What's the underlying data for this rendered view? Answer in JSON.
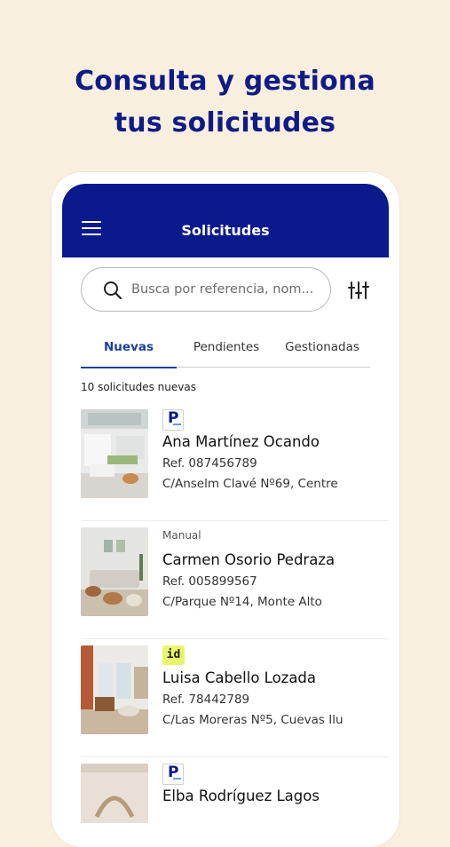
{
  "headline": {
    "line1": "Consulta y gestiona",
    "line2": "tus solicitudes"
  },
  "appbar": {
    "title": "Solicitudes",
    "menu_icon": "hamburger-menu-icon"
  },
  "search": {
    "placeholder": "Busca por referencia, nom...",
    "icon": "search-icon",
    "filter_icon": "filter-sliders-icon"
  },
  "tabs": [
    {
      "label": "Nuevas",
      "active": true
    },
    {
      "label": "Pendientes",
      "active": false
    },
    {
      "label": "Gestionadas",
      "active": false
    }
  ],
  "count_text": "10 solicitudes nuevas",
  "colors": {
    "brand_blue": "#0a1a8c",
    "accent_blue": "#1d3fa3",
    "background": "#f8efde",
    "id_badge": "#e8f56b"
  },
  "requests": [
    {
      "source": "p-logo",
      "source_label": "",
      "name": "Ana Martínez Ocando",
      "ref": "Ref. 087456789",
      "address": "C/Anselm Clavé Nº69, Centre"
    },
    {
      "source": "text",
      "source_label": "Manual",
      "name": "Carmen Osorio Pedraza",
      "ref": "Ref. 005899567",
      "address": "C/Parque Nº14, Monte Alto"
    },
    {
      "source": "id-logo",
      "source_label": "id",
      "name": "Luisa Cabello Lozada",
      "ref": "Ref. 78442789",
      "address": "C/Las Moreras Nº5, Cuevas Ilu"
    },
    {
      "source": "p-logo",
      "source_label": "",
      "name": "Elba Rodríguez Lagos",
      "ref": "",
      "address": ""
    }
  ]
}
